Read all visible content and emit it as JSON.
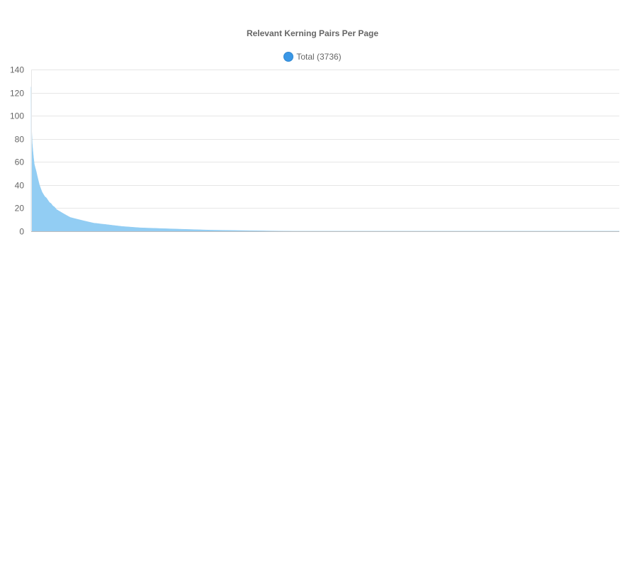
{
  "chart_data": {
    "type": "area",
    "title": "Relevant Kerning Pairs Per Page",
    "xlabel": "",
    "ylabel": "",
    "ylim": [
      0,
      140
    ],
    "yticks": [
      0,
      20,
      40,
      60,
      80,
      100,
      120,
      140
    ],
    "grid": true,
    "legend_position": "top",
    "series": [
      {
        "name": "Total (3736)",
        "color": "#3a97e6",
        "fill_color": "#92cdf3",
        "point_count": 3736,
        "values_sampled_descending": [
          125,
          100,
          86,
          76,
          70,
          64,
          58,
          55,
          52,
          48,
          44,
          40,
          37,
          34,
          32,
          30,
          29,
          27,
          25,
          24,
          22,
          21,
          19,
          18,
          17,
          16,
          15,
          14,
          13,
          12,
          11.5,
          11,
          10.5,
          10,
          9.5,
          9,
          8.5,
          8,
          7.5,
          7,
          6.8,
          6.5,
          6.2,
          6,
          5.7,
          5.4,
          5.1,
          4.8,
          4.5,
          4.2,
          4,
          3.8,
          3.6,
          3.4,
          3.2,
          3,
          2.9,
          2.8,
          2.7,
          2.6,
          2.5,
          2.4,
          2.3,
          2.2,
          2.1,
          2,
          1.9,
          1.8,
          1.7,
          1.6,
          1.5,
          1.4,
          1.3,
          1.2,
          1.1,
          1,
          0.95,
          0.9,
          0.85,
          0.8,
          0.75,
          0.7,
          0.65,
          0.6,
          0.55,
          0.5,
          0.45,
          0.4,
          0.35,
          0.3,
          0.25,
          0.2,
          0.15,
          0.1,
          0.05,
          0,
          0,
          0,
          0,
          0,
          0,
          0,
          0,
          0,
          0,
          0,
          0,
          0,
          0,
          0,
          0,
          0,
          0,
          0,
          0,
          0,
          0,
          0,
          0,
          0,
          0,
          0,
          0,
          0,
          0,
          0,
          0,
          0,
          0,
          0,
          0,
          0,
          0,
          0,
          0,
          0
        ]
      }
    ]
  }
}
